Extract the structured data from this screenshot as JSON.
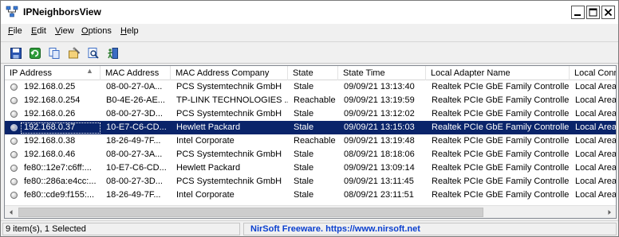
{
  "window": {
    "title": "IPNeighborsView"
  },
  "menu": [
    {
      "label": "File",
      "underline": "F",
      "rest": "ile"
    },
    {
      "label": "Edit",
      "underline": "E",
      "rest": "dit"
    },
    {
      "label": "View",
      "underline": "V",
      "rest": "iew"
    },
    {
      "label": "Options",
      "underline": "O",
      "rest": "ptions"
    },
    {
      "label": "Help",
      "underline": "H",
      "rest": "elp"
    }
  ],
  "toolbar": {
    "icons": [
      "save-icon",
      "refresh-icon",
      "copy-icon",
      "properties-icon",
      "find-icon",
      "exit-icon"
    ]
  },
  "columns": [
    "IP Address",
    "MAC Address",
    "MAC Address Company",
    "State",
    "State Time",
    "Local Adapter Name",
    "Local Conne"
  ],
  "rows": [
    {
      "ip": "192.168.0.25",
      "mac": "08-00-27-0A...",
      "company": "PCS Systemtechnik GmbH",
      "state": "Stale",
      "time": "09/09/21 13:13:40",
      "adapter": "Realtek PCIe GbE Family Controller",
      "conn": "Local Area"
    },
    {
      "ip": "192.168.0.254",
      "mac": "B0-4E-26-AE...",
      "company": "TP-LINK TECHNOLOGIES ...",
      "state": "Reachable",
      "time": "09/09/21 13:19:59",
      "adapter": "Realtek PCIe GbE Family Controller",
      "conn": "Local Area"
    },
    {
      "ip": "192.168.0.26",
      "mac": "08-00-27-3D...",
      "company": "PCS Systemtechnik GmbH",
      "state": "Stale",
      "time": "09/09/21 13:12:02",
      "adapter": "Realtek PCIe GbE Family Controller",
      "conn": "Local Area"
    },
    {
      "ip": "192.168.0.37",
      "mac": "10-E7-C6-CD...",
      "company": "Hewlett Packard",
      "state": "Stale",
      "time": "09/09/21 13:15:03",
      "adapter": "Realtek PCIe GbE Family Controller",
      "conn": "Local Area",
      "selected": true
    },
    {
      "ip": "192.168.0.38",
      "mac": "18-26-49-7F...",
      "company": "Intel Corporate",
      "state": "Reachable",
      "time": "09/09/21 13:19:48",
      "adapter": "Realtek PCIe GbE Family Controller",
      "conn": "Local Area"
    },
    {
      "ip": "192.168.0.46",
      "mac": "08-00-27-3A...",
      "company": "PCS Systemtechnik GmbH",
      "state": "Stale",
      "time": "08/09/21 18:18:06",
      "adapter": "Realtek PCIe GbE Family Controller",
      "conn": "Local Area"
    },
    {
      "ip": "fe80::12e7:c6ff:...",
      "mac": "10-E7-C6-CD...",
      "company": "Hewlett Packard",
      "state": "Stale",
      "time": "09/09/21 13:09:14",
      "adapter": "Realtek PCIe GbE Family Controller",
      "conn": "Local Area"
    },
    {
      "ip": "fe80::286a:e4cc:...",
      "mac": "08-00-27-3D...",
      "company": "PCS Systemtechnik GmbH",
      "state": "Stale",
      "time": "09/09/21 13:11:45",
      "adapter": "Realtek PCIe GbE Family Controller",
      "conn": "Local Area"
    },
    {
      "ip": "fe80::cde9:f155:...",
      "mac": "18-26-49-7F...",
      "company": "Intel Corporate",
      "state": "Stale",
      "time": "08/09/21 23:11:51",
      "adapter": "Realtek PCIe GbE Family Controller",
      "conn": "Local Area"
    }
  ],
  "status": {
    "count": "9 item(s), 1 Selected",
    "credit": "NirSoft Freeware. https://www.nirsoft.net"
  },
  "colors": {
    "selection": "#0a246a",
    "credit": "#0a3fcf"
  }
}
